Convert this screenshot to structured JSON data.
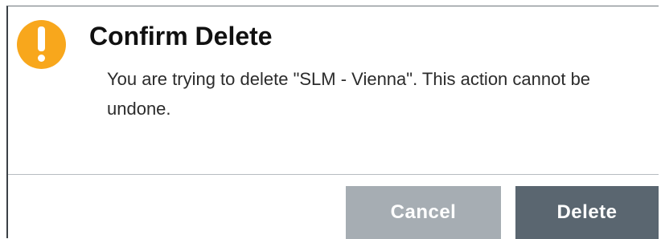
{
  "dialog": {
    "icon": "warning-exclamation-icon",
    "title": "Confirm Delete",
    "message": "You are trying to delete \"SLM - Vienna\". This action cannot be undone.",
    "buttons": {
      "cancel_label": "Cancel",
      "delete_label": "Delete"
    }
  },
  "colors": {
    "warning": "#f8a71c",
    "cancel_button": "#a6adb3",
    "delete_button": "#5a6670",
    "divider": "#b7bcc0"
  }
}
